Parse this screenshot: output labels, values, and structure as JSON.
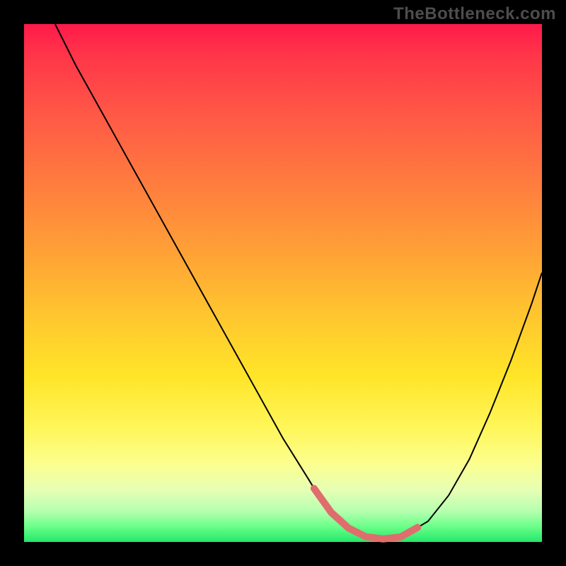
{
  "watermark": "TheBottleneck.com",
  "chart_data": {
    "type": "line",
    "title": "",
    "xlabel": "",
    "ylabel": "",
    "xlim": [
      0,
      100
    ],
    "ylim": [
      0,
      100
    ],
    "grid": false,
    "legend": false,
    "series": [
      {
        "name": "bottleneck-curve",
        "x": [
          6,
          10,
          15,
          20,
          25,
          30,
          35,
          40,
          45,
          50,
          55,
          58,
          62,
          66,
          70,
          73,
          78,
          82,
          86,
          90,
          94,
          98,
          100
        ],
        "y": [
          100,
          92,
          83,
          74,
          65,
          56,
          47,
          38,
          29,
          20,
          12,
          7,
          3,
          1,
          0.5,
          1,
          4,
          9,
          16,
          25,
          35,
          46,
          52
        ]
      }
    ],
    "highlight_range": {
      "name": "optimal-zone",
      "x": [
        56,
        76
      ],
      "y_approx": [
        6,
        5
      ]
    },
    "gradient_stops": [
      {
        "pos": 0,
        "color": "#ff1a4b"
      },
      {
        "pos": 18,
        "color": "#ff5a46"
      },
      {
        "pos": 44,
        "color": "#ffa136"
      },
      {
        "pos": 68,
        "color": "#ffe528"
      },
      {
        "pos": 85,
        "color": "#fbff8f"
      },
      {
        "pos": 97,
        "color": "#6bff8a"
      },
      {
        "pos": 100,
        "color": "#22e86a"
      }
    ]
  }
}
